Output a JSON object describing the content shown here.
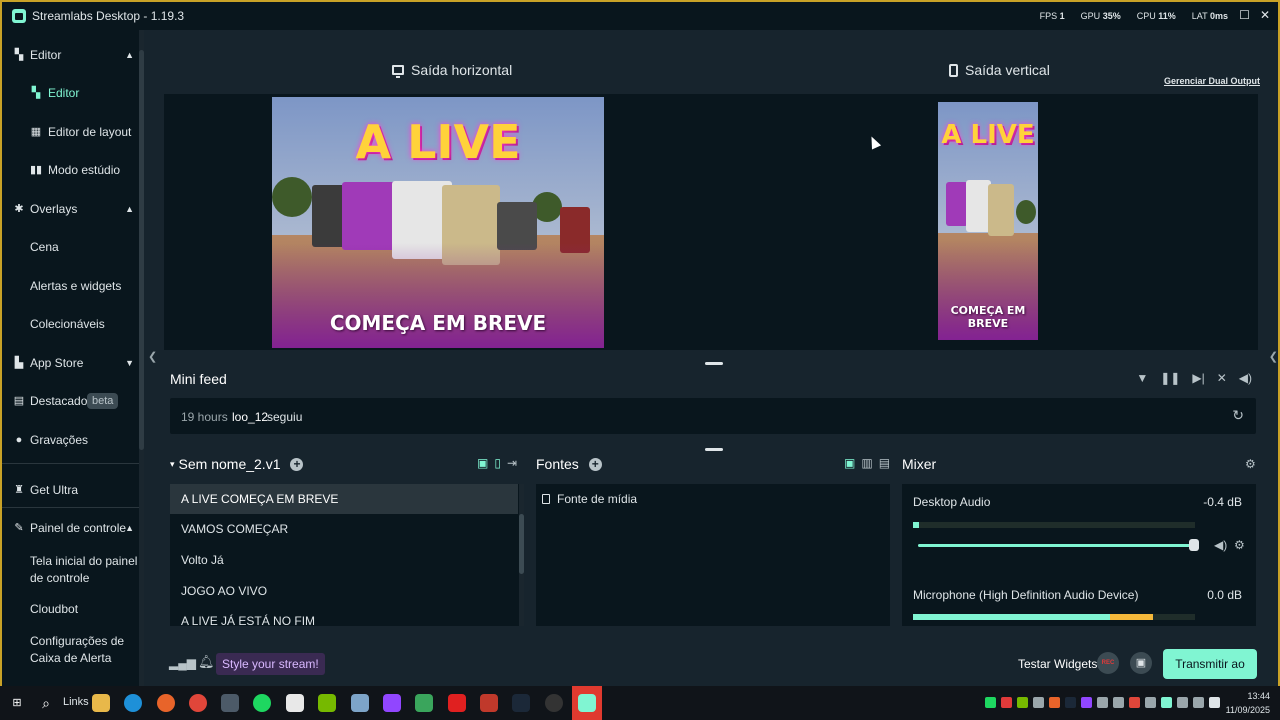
{
  "window": {
    "title": "Streamlabs Desktop - 1.19.3",
    "stats": {
      "fps_label": "FPS",
      "fps_value": "1",
      "gpu_label": "GPU",
      "gpu_value": "35%",
      "cpu_label": "CPU",
      "cpu_value": "11%",
      "lat_label": "LAT",
      "lat_value": "0ms"
    }
  },
  "sidebar": {
    "editor_group": "Editor",
    "editor": "Editor",
    "layout_editor": "Editor de layout",
    "studio_mode": "Modo estúdio",
    "overlays_group": "Overlays",
    "scene": "Cena",
    "alerts_widgets": "Alertas e widgets",
    "collectibles": "Colecionáveis",
    "app_store": "App Store",
    "highlighter": "Destacador",
    "highlighter_badge": "beta",
    "recordings": "Gravações",
    "get_ultra": "Get Ultra",
    "dashboard_group": "Painel de controle",
    "dashboard_home": "Tela inicial do painel de controle",
    "cloudbot": "Cloudbot",
    "alertbox_settings": "Configurações de Caixa de Alerta"
  },
  "outputs": {
    "horizontal": "Saída horizontal",
    "vertical": "Saída vertical",
    "manage_dual": "Gerenciar Dual Output"
  },
  "preview": {
    "headline": "A LIVE",
    "subline": "COMEÇA EM BREVE"
  },
  "minifeed": {
    "title": "Mini feed",
    "events": [
      {
        "time": "19 hours",
        "user": "loo_12",
        "action": "seguiu"
      }
    ]
  },
  "scenes": {
    "title": "Sem nome_2.v1",
    "items": [
      "A LIVE COMEÇA EM BREVE",
      "VAMOS COMEÇAR",
      "Volto Já",
      "JOGO AO VIVO",
      "A LIVE JÁ ESTÁ NO FIM"
    ],
    "selected_index": 0
  },
  "sources": {
    "title": "Fontes",
    "items": [
      "Fonte de mídia"
    ]
  },
  "mixer": {
    "title": "Mixer",
    "channels": [
      {
        "name": "Desktop Audio",
        "db": "-0.4 dB",
        "level": 0.0,
        "volume": 1.0
      },
      {
        "name": "Microphone (High Definition Audio Device)",
        "db": "0.0 dB",
        "level": 0.85
      }
    ]
  },
  "footer": {
    "style_stream": "Style your stream!",
    "test_widgets": "Testar Widgets",
    "rec": "REC",
    "go_live": "Transmitir ao vivo"
  },
  "taskbar": {
    "links": "Links",
    "time": "13:44",
    "date": "11/09/2025"
  },
  "colors": {
    "accent": "#80f5d2",
    "background": "#17242d",
    "panel": "#09161d",
    "frame_border": "#c9a227"
  }
}
